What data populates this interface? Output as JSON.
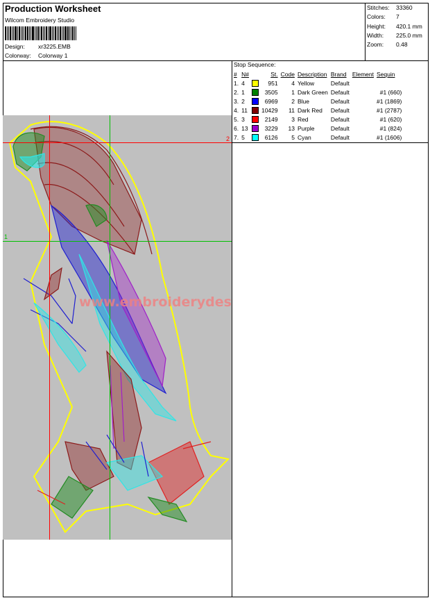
{
  "header": {
    "title": "Production Worksheet",
    "software": "Wilcom Embroidery Studio",
    "design_label": "Design:",
    "design_value": "xr3225.EMB",
    "colorway_label": "Colorway:",
    "colorway_value": "Colorway 1"
  },
  "stats": [
    {
      "label": "Stitches:",
      "value": "33360"
    },
    {
      "label": "Colors:",
      "value": "7"
    },
    {
      "label": "Height:",
      "value": "420.1 mm"
    },
    {
      "label": "Width:",
      "value": "225.0 mm"
    },
    {
      "label": "Zoom:",
      "value": "0.48"
    }
  ],
  "stop_sequence": {
    "heading": "Stop Sequence:",
    "columns": [
      "#",
      "N#",
      "St.",
      "Code",
      "Description",
      "Brand",
      "Element",
      "Sequin"
    ],
    "rows": [
      {
        "num": "1.",
        "n": "4",
        "color": "#ffff00",
        "st": "951",
        "code": "4",
        "desc": "Yellow",
        "brand": "Default",
        "element": "",
        "sequin": ""
      },
      {
        "num": "2.",
        "n": "1",
        "color": "#008000",
        "st": "3505",
        "code": "1",
        "desc": "Dark Green",
        "brand": "Default",
        "element": "",
        "sequin": "#1 (660)"
      },
      {
        "num": "3.",
        "n": "2",
        "color": "#0000ff",
        "st": "6969",
        "code": "2",
        "desc": "Blue",
        "brand": "Default",
        "element": "",
        "sequin": "#1 (1869)"
      },
      {
        "num": "4.",
        "n": "11",
        "color": "#800000",
        "st": "10429",
        "code": "11",
        "desc": "Dark Red",
        "brand": "Default",
        "element": "",
        "sequin": "#1 (2787)"
      },
      {
        "num": "5.",
        "n": "3",
        "color": "#ff0000",
        "st": "2149",
        "code": "3",
        "desc": "Red",
        "brand": "Default",
        "element": "",
        "sequin": "#1 (620)"
      },
      {
        "num": "6.",
        "n": "13",
        "color": "#9900cc",
        "st": "3229",
        "code": "13",
        "desc": "Purple",
        "brand": "Default",
        "element": "",
        "sequin": "#1 (824)"
      },
      {
        "num": "7.",
        "n": "5",
        "color": "#00ffff",
        "st": "6126",
        "code": "5",
        "desc": "Cyan",
        "brand": "Default",
        "element": "",
        "sequin": "#1 (1606)"
      }
    ]
  },
  "preview": {
    "guide_label_1": "1",
    "guide_label_2": "2",
    "watermark": "www.embroiderydesigns.com",
    "colors": {
      "background": "#c0c0c0",
      "guide_red": "#ff0000",
      "guide_green": "#00c000",
      "outline": "#ffff00",
      "dark_red": "#8b1a1a",
      "green": "#228b22",
      "blue": "#1f1fd0",
      "cyan": "#2ee6e6",
      "purple": "#a020c8",
      "red": "#e02020"
    }
  }
}
